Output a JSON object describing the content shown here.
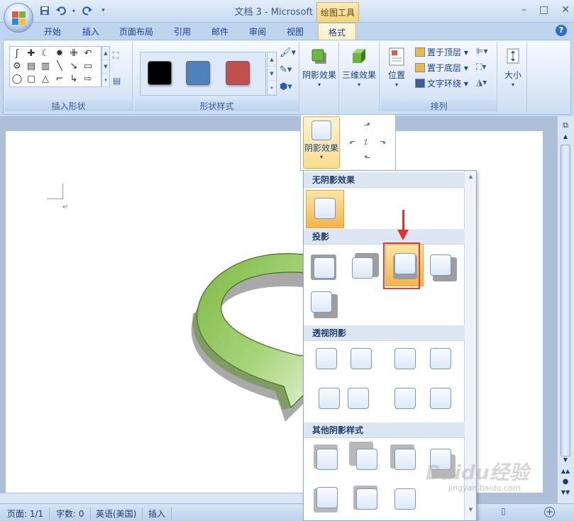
{
  "window": {
    "title": "文档 3 - Microsoft Word",
    "context_tab_label": "绘图工具",
    "controls": [
      "minimize-icon",
      "maximize-icon",
      "close-icon"
    ]
  },
  "quick_access": [
    "save-icon",
    "undo-icon",
    "redo-icon",
    "customize-icon"
  ],
  "tabs": [
    {
      "label": "开始"
    },
    {
      "label": "插入"
    },
    {
      "label": "页面布局"
    },
    {
      "label": "引用"
    },
    {
      "label": "邮件"
    },
    {
      "label": "审阅"
    },
    {
      "label": "视图"
    },
    {
      "label": "格式",
      "active": true
    }
  ],
  "ribbon": {
    "insert_shapes_label": "插入形状",
    "shape_styles_label": "形状样式",
    "shape_styles": [
      "#000000",
      "#4f81bd",
      "#c0504d"
    ],
    "shadow_effects_label": "阴影效果",
    "three_d_effects_label": "三维效果",
    "position_label": "位置",
    "bring_to_front": "置于顶层",
    "send_to_back": "置于底层",
    "text_wrap": "文字环绕",
    "arrange_label": "排列",
    "size_label": "大小"
  },
  "dropdown": {
    "shadow_button_label": "阴影效果"
  },
  "shadow_menu": {
    "no_shadow": "无阴影效果",
    "drop_shadow": "投影",
    "perspective_shadow": "透视阴影",
    "other_shadow": "其他阴影样式"
  },
  "statusbar": {
    "page": "页面: 1/1",
    "words": "字数: 0",
    "language": "英语(美国)",
    "mode": "插入"
  },
  "watermark": {
    "main": "Baidu经验",
    "sub": "jingyan.baidu.com"
  }
}
